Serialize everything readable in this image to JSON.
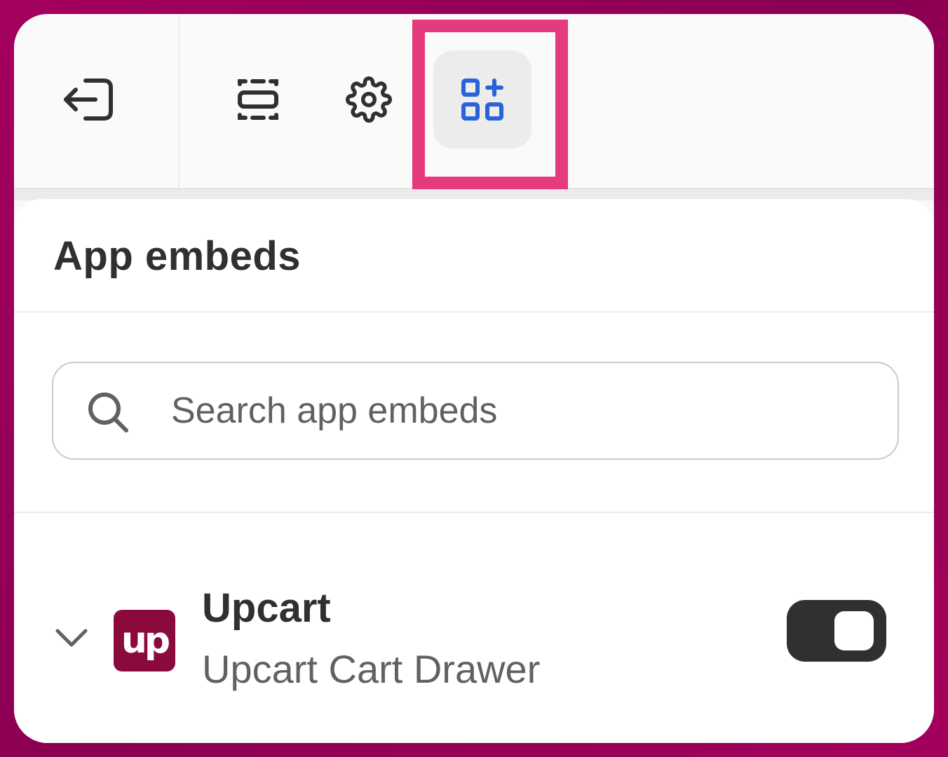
{
  "panel": {
    "title": "App embeds"
  },
  "search": {
    "placeholder": "Search app embeds",
    "value": ""
  },
  "apps": [
    {
      "name": "Upcart",
      "subtitle": "Upcart Cart Drawer",
      "logo_text": "up",
      "logo_color": "#8b0a3e",
      "enabled": true
    }
  ],
  "colors": {
    "accent_blue": "#2a63d8",
    "highlight": "#e63a7e",
    "toggle_on": "#303030"
  },
  "toolbar": {
    "icons": [
      "exit-icon",
      "sections-icon",
      "gear-icon",
      "app-embeds-icon"
    ],
    "active": "app-embeds-icon"
  }
}
